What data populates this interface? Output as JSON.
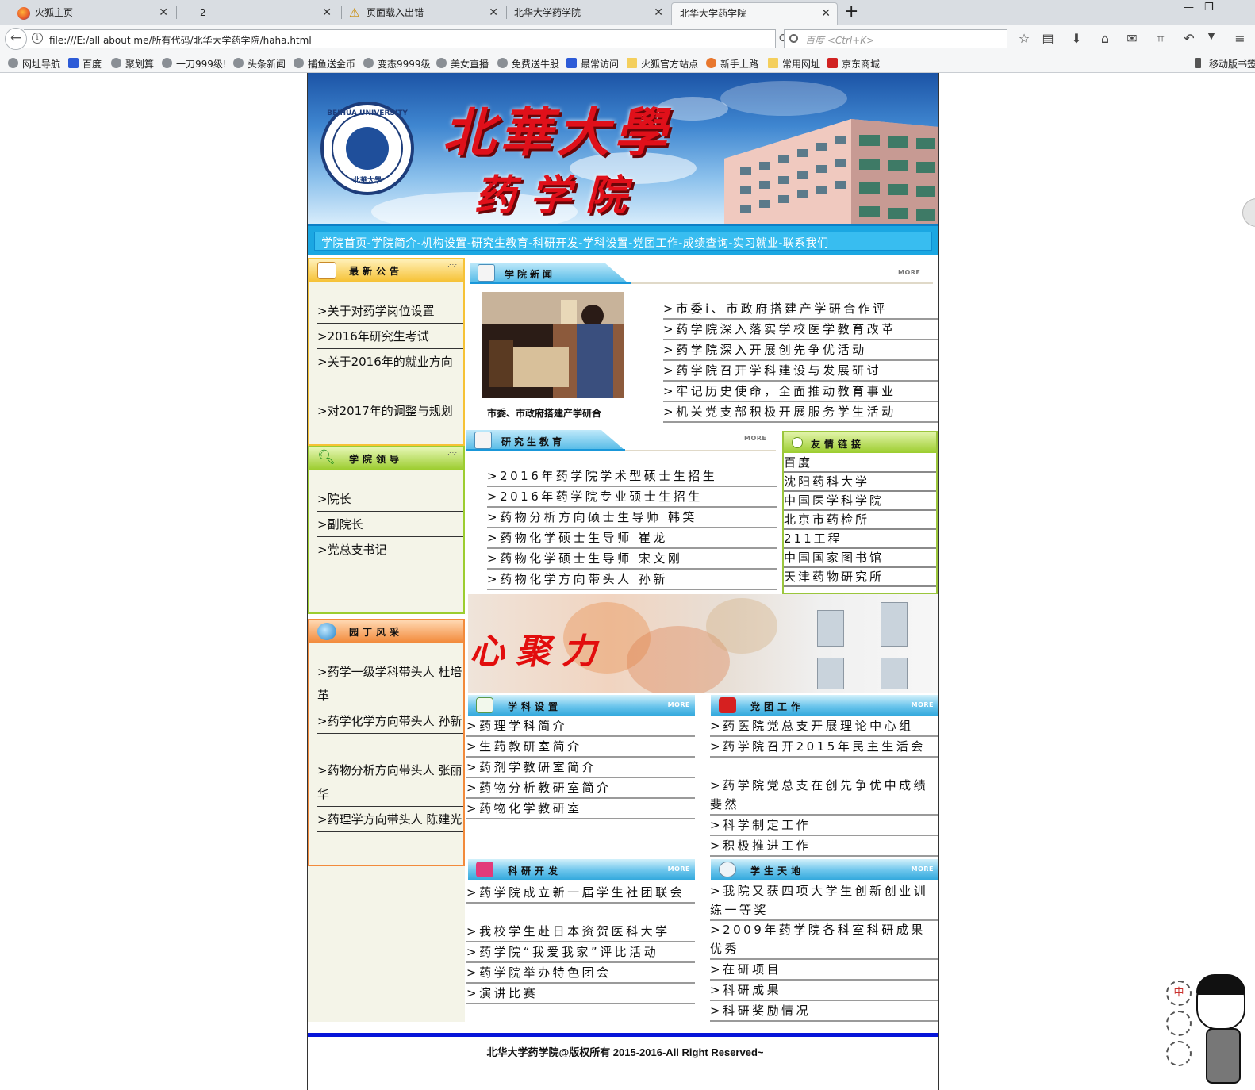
{
  "browser": {
    "tabs": [
      {
        "title": "火狐主页",
        "icon": "firefox-icon"
      },
      {
        "title": "2",
        "icon": ""
      },
      {
        "title": "页面载入出错",
        "icon": "warning-icon"
      },
      {
        "title": "北华大学药学院",
        "icon": ""
      },
      {
        "title": "北华大学药学院",
        "icon": "",
        "active": true
      }
    ],
    "url": "file:///E:/all about me/所有代码/北华大学药学院/haha.html",
    "search_placeholder": "百度 <Ctrl+K>",
    "bookmarks": [
      "网址导航",
      "百度",
      "聚划算",
      "一刀999级!",
      "头条新闻",
      "捕鱼送金币",
      "变态9999级",
      "美女直播",
      "免费送牛股",
      "最常访问",
      "火狐官方站点",
      "新手上路",
      "常用网址",
      "京东商城",
      "移动版书签"
    ]
  },
  "site": {
    "banner": {
      "title": "北華大學",
      "subtitle": "药学院",
      "seal_text": "BEIHUA UNIVERSITY",
      "seal_cn": "北華大學"
    },
    "mainnav": "学院首页-学院简介-机构设置-研究生教育-科研开发-学科设置-党团工作-成绩查询-实习就业-联系我们",
    "notices": {
      "title": "最新公告",
      "items": [
        ">关于对药学岗位设置",
        ">2016年研究生考试",
        ">关于2016年的就业方向",
        ">对2017年的调整与规划"
      ]
    },
    "leaders": {
      "title": "学院领导",
      "items": [
        ">院长",
        ">副院长",
        ">党总支书记"
      ]
    },
    "teachers": {
      "title": "园丁风采",
      "items": [
        ">药学一级学科带头人 杜培革",
        ">药学化学方向带头人 孙新",
        ">药物分析方向带头人 张丽华",
        ">药理学方向带头人 陈建光"
      ]
    },
    "news": {
      "title": "学院新闻",
      "more": "MORE",
      "photo_caption": "市委、市政府搭建产学研合",
      "items": [
        ">市委i、市政府搭建产学研合作评",
        ">药学院深入落实学校医学教育改革",
        ">药学院深入开展创先争优活动",
        ">药学院召开学科建设与发展研讨",
        ">牢记历史使命，全面推动教育事业",
        ">机关党支部积极开展服务学生活动"
      ]
    },
    "graduate": {
      "title": "研究生教育",
      "more": "MORE",
      "items": [
        ">2016年药学院学术型硕士生招生",
        ">2016年药学院专业硕士生招生",
        ">药物分析方向硕士生导师 韩笑",
        ">药物化学硕士生导师 崔龙",
        ">药物化学硕士生导师 宋文刚",
        ">药物化学方向带头人 孙新"
      ]
    },
    "links": {
      "title": "友情链接",
      "items": [
        "百度",
        "沈阳药科大学",
        "中国医学科学院",
        "北京市药检所",
        "211工程",
        "中国国家图书馆",
        "天津药物研究所"
      ]
    },
    "mid_banner_text": "心聚力",
    "discipline": {
      "title": "学科设置",
      "more": "MORE",
      "items": [
        ">药理学科简介",
        ">生药教研室简介",
        ">药剂学教研室简介",
        ">药物分析教研室简介",
        ">药物化学教研室"
      ]
    },
    "party": {
      "title": "党团工作",
      "more": "MORE",
      "items": [
        ">药医院党总支开展理论中心组",
        ">药学院召开2015年民主生活会",
        ">药学院党总支在创先争优中成绩斐然",
        ">科学制定工作",
        ">积极推进工作"
      ]
    },
    "research": {
      "title": "科研开发",
      "more": "MORE",
      "items": [
        ">药学院成立新一届学生社团联会",
        ">我校学生赴日本资贺医科大学",
        ">药学院“我爱我家”评比活动",
        ">药学院举办特色团会",
        ">演讲比赛"
      ]
    },
    "students": {
      "title": "学生天地",
      "more": "MORE",
      "items": [
        ">我院又获四项大学生创新创业训练一等奖",
        ">2009年药学院各科室科研成果优秀",
        ">在研项目",
        ">科研成果",
        ">科研奖励情况"
      ]
    },
    "footer": "北华大学药学院@版权所有 2015-2016-All Right Reserved~"
  },
  "widget": {
    "bubbles": [
      "中",
      "",
      ""
    ]
  },
  "colors": {
    "nav_blue": "#1ba7e2",
    "footer_line": "#0615d9",
    "notice_orange": "#f6c236",
    "leader_green": "#9ccd2f",
    "teacher_orange": "#f28a3b"
  }
}
